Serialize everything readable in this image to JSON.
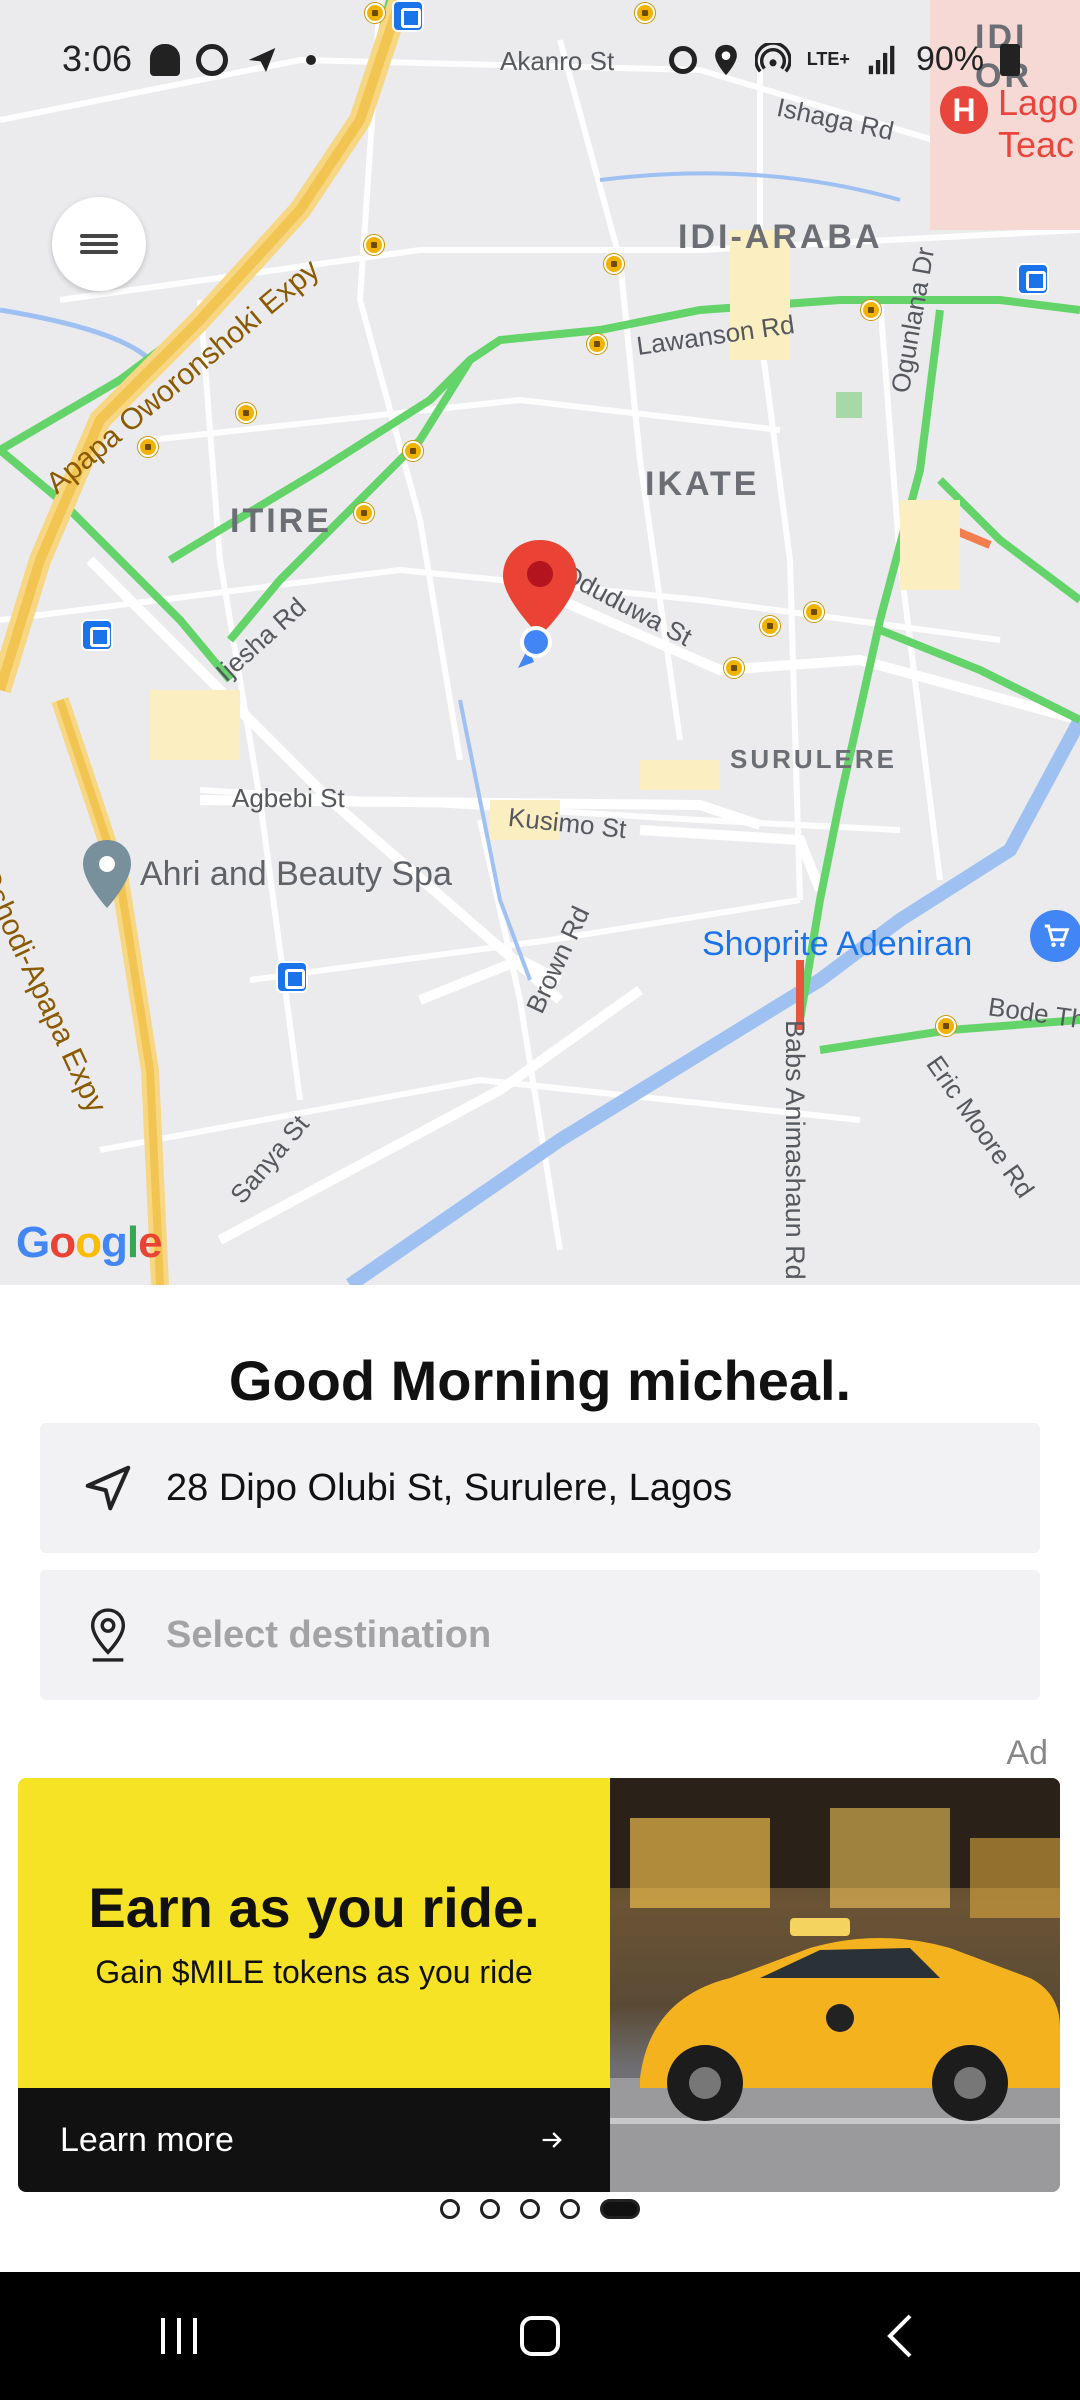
{
  "status_bar": {
    "time": "3:06",
    "battery": "90%",
    "network": "LTE+"
  },
  "map": {
    "districts": [
      "IDI-ARABA",
      "IKATE",
      "ITIRE",
      "SURULERE",
      "IDI OR"
    ],
    "roads": [
      "Akanro St",
      "Ishaga Rd",
      "Lawanson Rd",
      "Ogunlana Dr",
      "Ijesha Rd",
      "Oduduwa St",
      "Agbebi St",
      "Kusimo St",
      "Brown Rd",
      "Sanya St",
      "Babs Animashaun Rd",
      "Eric Moore Rd",
      "Bode Th"
    ],
    "expressways": [
      "Apapa Oworonshoki Expy",
      "Oshodi-Apapa Expy"
    ],
    "pois": {
      "spa": "Ahri and Beauty Spa",
      "shop": "Shoprite Adeniran",
      "hospital": "Lago Teac"
    },
    "logo": "Google"
  },
  "greeting": "Good Morning micheal.",
  "pickup": {
    "value": "28 Dipo Olubi St, Surulere, Lagos"
  },
  "destination": {
    "placeholder": "Select destination"
  },
  "ad": {
    "tag": "Ad",
    "title": "Earn as you ride.",
    "subtitle": "Gain $MILE tokens as you ride",
    "cta": "Learn more",
    "cta_icon": "arrow-right-icon",
    "carousel_total": 5,
    "carousel_active": 5
  },
  "colors": {
    "accent_yellow": "#f7e325",
    "pin_red": "#e53935",
    "location_blue": "#4285f4"
  }
}
